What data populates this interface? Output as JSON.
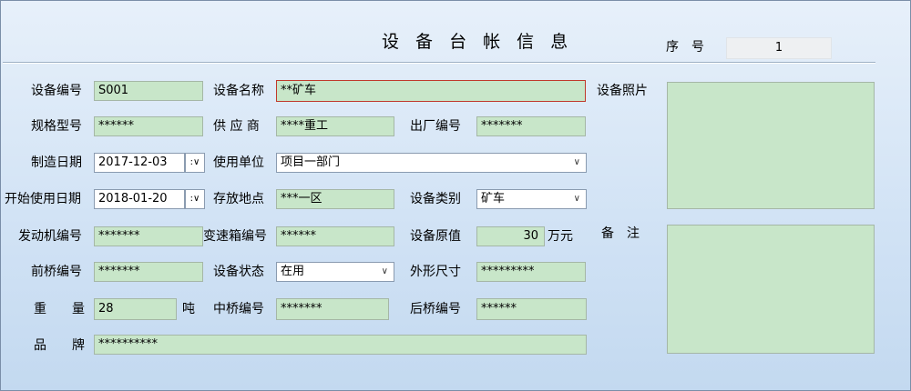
{
  "title": "设 备 台 帐 信 息",
  "seq": {
    "label": "序　号",
    "value": "1"
  },
  "labels": {
    "device_no": "设备编号",
    "device_name": "设备名称",
    "photo": "设备照片",
    "spec_model": "规格型号",
    "supplier": "供 应 商",
    "factory_no": "出厂编号",
    "mfg_date": "制造日期",
    "use_unit": "使用单位",
    "start_date": "开始使用日期",
    "location": "存放地点",
    "category": "设备类别",
    "engine_no": "发动机编号",
    "gearbox_no": "变速箱编号",
    "orig_value": "设备原值",
    "value_unit": "万元",
    "remark": "备　注",
    "front_axle": "前桥编号",
    "status": "设备状态",
    "dimensions": "外形尺寸",
    "weight": "重　　量",
    "weight_unit": "吨",
    "mid_axle": "中桥编号",
    "rear_axle": "后桥编号",
    "brand": "品　　牌"
  },
  "values": {
    "device_no": "S001",
    "device_name": "**矿车",
    "spec_model": "******",
    "supplier": "****重工",
    "factory_no": "*******",
    "mfg_date": "2017-12-03",
    "use_unit": "项目一部门",
    "start_date": "2018-01-20",
    "location": "***一区",
    "category": "矿车",
    "engine_no": "*******",
    "gearbox_no": "******",
    "orig_value": "30",
    "front_axle": "*******",
    "status": "在用",
    "dimensions": "*********",
    "weight": "28",
    "mid_axle": "*******",
    "rear_axle": "******",
    "brand": "**********"
  },
  "icons": {
    "dropdown": "chevron-down-icon",
    "date_picker": "date-picker-icon"
  },
  "colors": {
    "field_bg": "#c8e6c9",
    "invalid_border": "#c0392b",
    "window_bg": "#d2e3f5"
  }
}
